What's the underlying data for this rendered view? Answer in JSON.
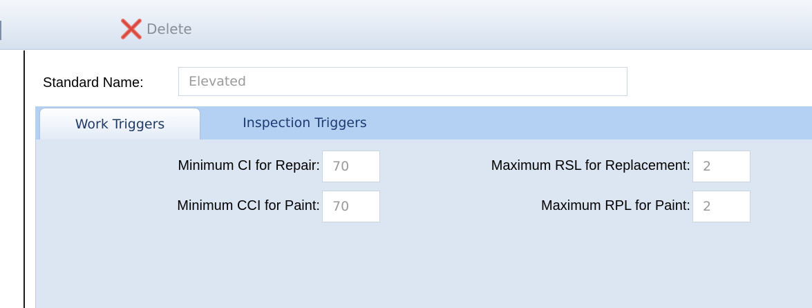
{
  "toolbar": {
    "delete_label": "Delete",
    "delete_icon": "close-x-icon",
    "delete_icon_color": "#e05a4f"
  },
  "standard": {
    "name_label": "Standard Name:",
    "name_value": "Elevated"
  },
  "tabs": [
    {
      "label": "Work Triggers",
      "selected": true
    },
    {
      "label": "Inspection Triggers",
      "selected": false
    }
  ],
  "work_triggers": {
    "min_ci_repair_label": "Minimum CI for Repair:",
    "min_ci_repair_value": "70",
    "min_cci_paint_label": "Minimum CCI for Paint:",
    "min_cci_paint_value": "70",
    "max_rsl_replacement_label": "Maximum RSL for Replacement:",
    "max_rsl_replacement_value": "2",
    "max_rpl_paint_label": "Maximum RPL for Paint:",
    "max_rpl_paint_value": "2"
  },
  "colors": {
    "tab_strip": "#b4d1f4",
    "panel": "#dce6f2",
    "tab_text": "#1a3a6b"
  }
}
